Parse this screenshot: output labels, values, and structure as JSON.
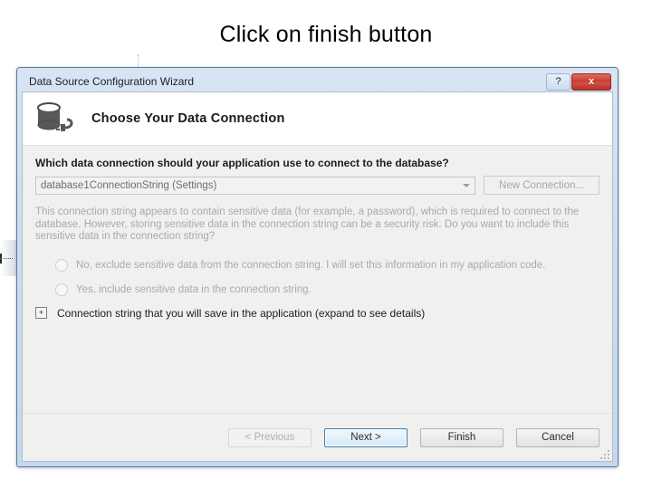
{
  "annotation": {
    "text": "Click on finish button"
  },
  "window": {
    "title": "Data Source Configuration Wizard",
    "help_button": "?",
    "close_button": "x"
  },
  "header": {
    "icon": "database-connection-icon",
    "title": "Choose Your Data Connection"
  },
  "main": {
    "question": "Which data connection should your application use to connect to the database?",
    "connection_combo": {
      "value": "database1ConnectionString (Settings)",
      "arrow_icon": "chevron-down-icon"
    },
    "new_connection_button": "New Connection...",
    "warning_text": "This connection string appears to contain sensitive data (for example, a password), which is required to connect to the database. However, storing sensitive data in the connection string can be a security risk. Do you want to include this sensitive data in the connection string?",
    "options": [
      {
        "label": "No, exclude sensitive data from the connection string. I will set this information in my application code.",
        "selected": false
      },
      {
        "label": "Yes, include sensitive data in the connection string.",
        "selected": false
      }
    ],
    "expander": {
      "glyph": "+",
      "label": "Connection string that you will save in the application (expand to see details)"
    }
  },
  "footer": {
    "buttons": [
      {
        "label": "< Previous",
        "state": "disabled"
      },
      {
        "label": "Next >",
        "state": "default"
      },
      {
        "label": "Finish",
        "state": "normal"
      },
      {
        "label": "Cancel",
        "state": "normal"
      }
    ]
  },
  "colors": {
    "accent": "#3c7fb1",
    "close_red": "#c63a33",
    "title_bar": "#cfddee",
    "body": "#f0f0ef",
    "disabled_text": "#a9a9a9"
  }
}
